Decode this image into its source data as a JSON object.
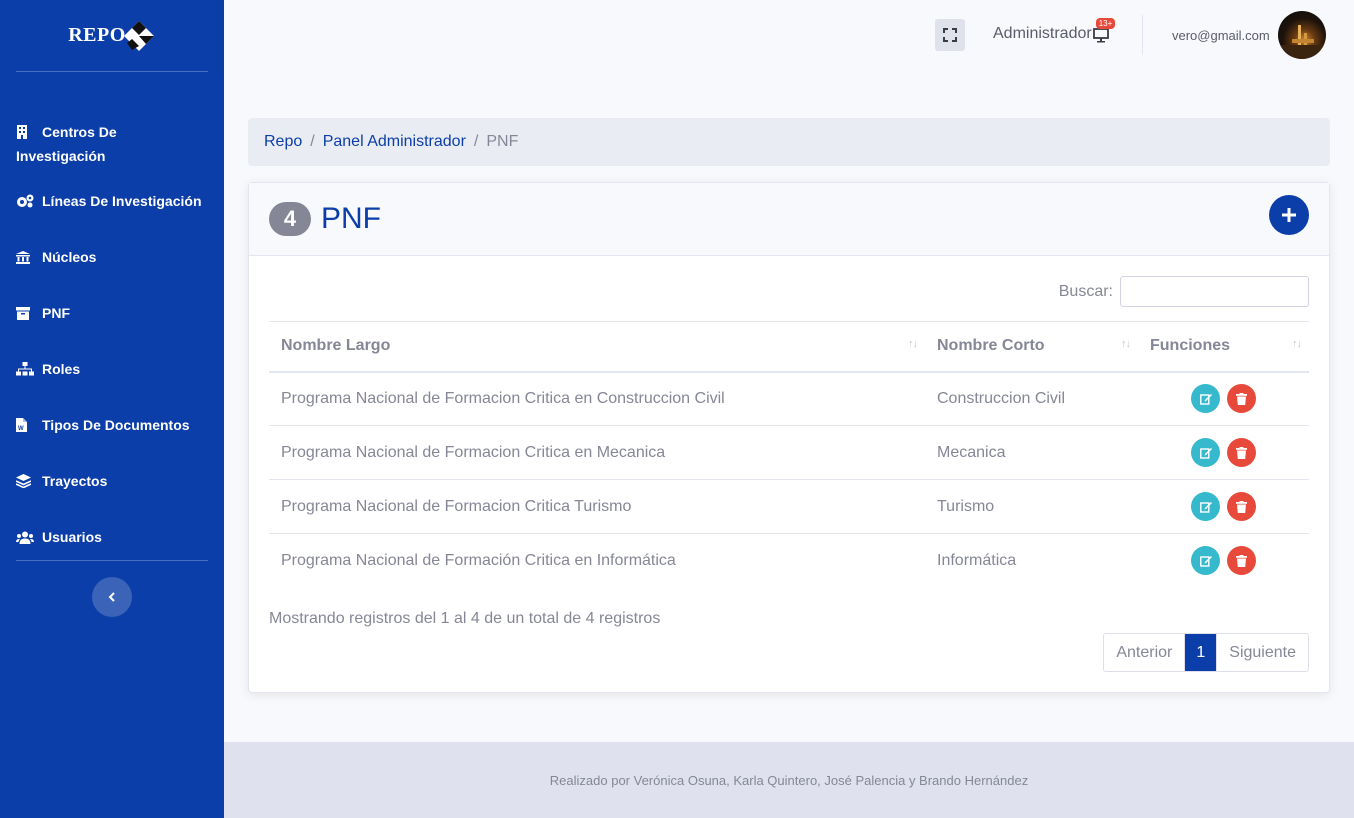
{
  "brand": {
    "name": "REPO"
  },
  "sidebar": {
    "items": [
      {
        "label": "Centros De Investigación",
        "icon": "building-icon"
      },
      {
        "label": "Líneas De Investigación",
        "icon": "cogs-icon"
      },
      {
        "label": "Núcleos",
        "icon": "university-icon"
      },
      {
        "label": "PNF",
        "icon": "archive-icon"
      },
      {
        "label": "Roles",
        "icon": "sitemap-icon"
      },
      {
        "label": "Tipos De Documentos",
        "icon": "file-word-icon"
      },
      {
        "label": "Trayectos",
        "icon": "layer-group-icon"
      },
      {
        "label": "Usuarios",
        "icon": "users-icon"
      }
    ],
    "toggle_icon": "chevron-left-icon"
  },
  "topbar": {
    "user_role": "Administrador",
    "alert_badge": "13+",
    "user_email": "vero@gmail.com"
  },
  "breadcrumb": {
    "items": [
      "Repo",
      "Panel Administrador"
    ],
    "current": "PNF"
  },
  "card": {
    "count": "4",
    "title": "PNF"
  },
  "search": {
    "label": "Buscar:",
    "value": ""
  },
  "table": {
    "headers": [
      "Nombre Largo",
      "Nombre Corto",
      "Funciones"
    ],
    "rows": [
      {
        "largo": "Programa Nacional de Formacion Critica en Construccion Civil",
        "corto": "Construccion Civil"
      },
      {
        "largo": "Programa Nacional de Formacion Critica en Mecanica",
        "corto": "Mecanica"
      },
      {
        "largo": "Programa Nacional de Formacion Critica Turismo",
        "corto": "Turismo"
      },
      {
        "largo": "Programa Nacional de Formación Critica en Informática",
        "corto": "Informática"
      }
    ]
  },
  "pagination": {
    "info": "Mostrando registros del 1 al 4 de un total de 4 registros",
    "prev": "Anterior",
    "current": "1",
    "next": "Siguiente"
  },
  "footer": {
    "text": "Realizado por Verónica Osuna, Karla Quintero, José Palencia y Brando Hernández"
  },
  "colors": {
    "primary": "#0b3ea8",
    "info": "#36b9cc",
    "danger": "#e74a3b",
    "muted": "#858796"
  }
}
